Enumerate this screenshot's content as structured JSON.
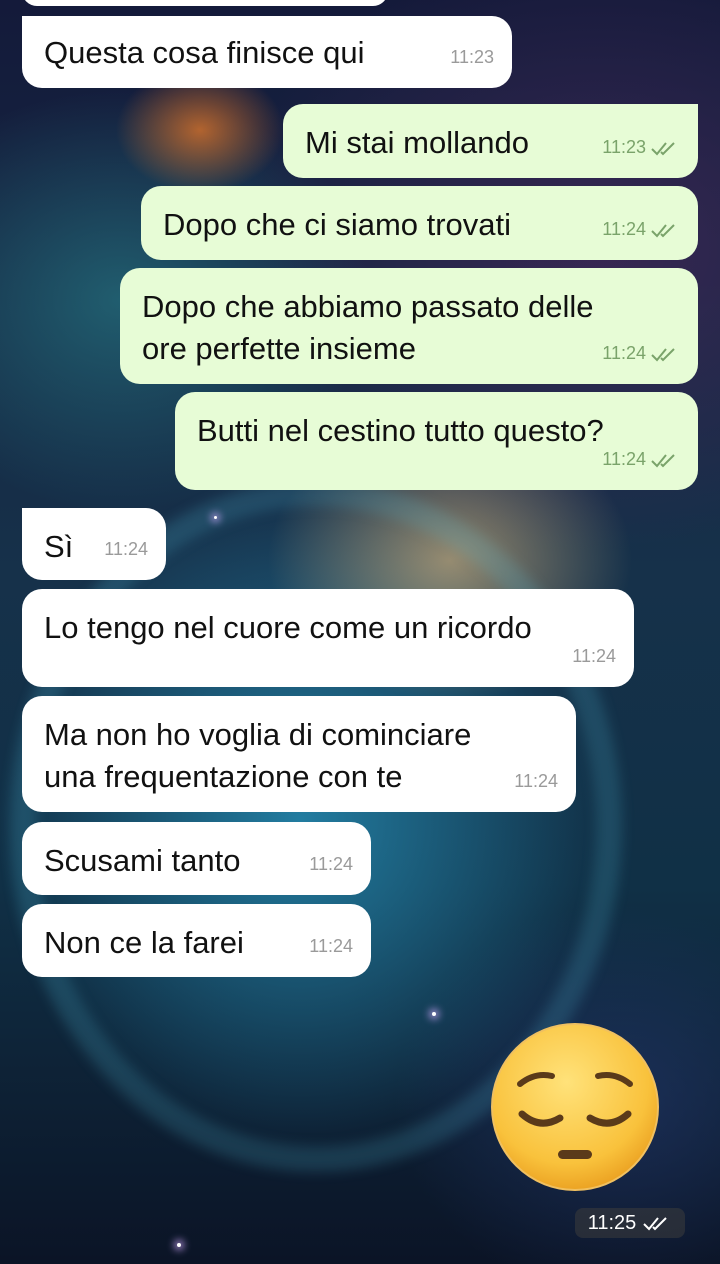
{
  "messages": [
    {
      "text": "Questa cosa finisce qui",
      "time": "11:23",
      "from": "them"
    },
    {
      "text": "Mi stai mollando",
      "time": "11:23",
      "from": "me"
    },
    {
      "text": "Dopo che ci siamo trovati",
      "time": "11:24",
      "from": "me"
    },
    {
      "text1": "Dopo che abbiamo passato delle",
      "text2": "ore perfette insieme",
      "time": "11:24",
      "from": "me"
    },
    {
      "text": "Butti nel cestino tutto questo?",
      "time": "11:24",
      "from": "me"
    },
    {
      "text": "Sì",
      "time": "11:24",
      "from": "them"
    },
    {
      "text": "Lo tengo nel cuore come un ricordo",
      "time": "11:24",
      "from": "them"
    },
    {
      "text1": "Ma non ho voglia di cominciare",
      "text2": "una frequentazione con te",
      "time": "11:24",
      "from": "them"
    },
    {
      "text": "Scusami tanto",
      "time": "11:24",
      "from": "them"
    },
    {
      "text": "Non ce la farei",
      "time": "11:24",
      "from": "them"
    }
  ],
  "sticker": {
    "name": "pensive-face-emoji",
    "time": "11:25"
  },
  "colors": {
    "outgoing_bubble": "#e7fcd6",
    "incoming_bubble": "#ffffff",
    "read_check": "#4fc3f7"
  }
}
